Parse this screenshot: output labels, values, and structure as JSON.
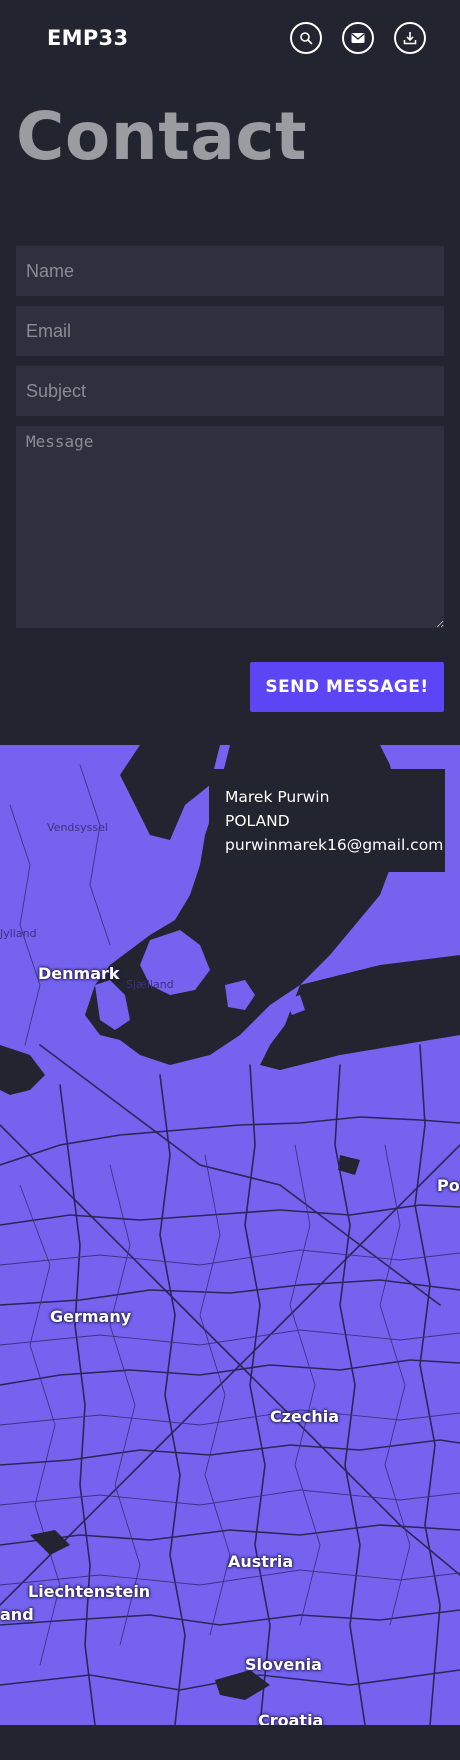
{
  "header": {
    "brand": "EMP33",
    "icons": [
      "search-icon",
      "mail-icon",
      "download-icon"
    ]
  },
  "page_title": "Contact",
  "form": {
    "name_placeholder": "Name",
    "email_placeholder": "Email",
    "subject_placeholder": "Subject",
    "message_placeholder": "Message",
    "submit_label": "SEND MESSAGE!"
  },
  "map": {
    "info": {
      "name": "Marek Purwin",
      "country": "POLAND",
      "email": "purwinmarek16@gmail.com"
    },
    "labels": {
      "denmark": "Denmark",
      "germany": "Germany",
      "czechia": "Czechia",
      "austria": "Austria",
      "liechtenstein": "Liechtenstein",
      "slovenia": "Slovenia",
      "poland_partial": "Po",
      "switzerland_partial": "and",
      "croatia_partial": "Croatia"
    },
    "small_labels": {
      "vendsyssel": "Vendsyssel",
      "jylland": "Jylland",
      "sjaelland": "Sjælland"
    }
  },
  "colors": {
    "background": "#22242f",
    "accent": "#5c45f4",
    "map_land": "#7563f0",
    "title": "#9a9ca1"
  }
}
